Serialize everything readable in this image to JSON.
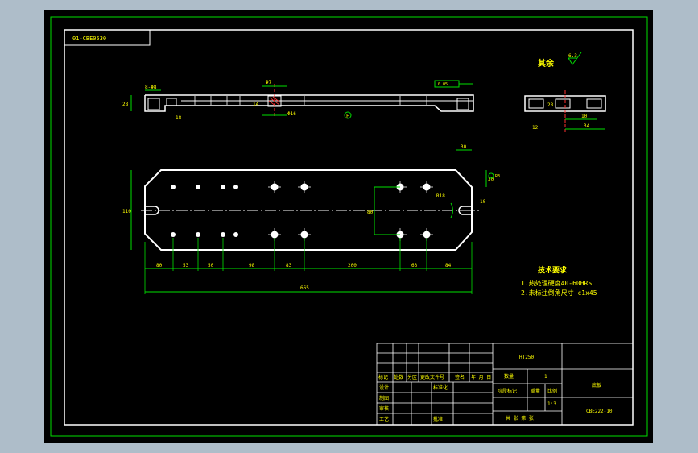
{
  "drawing_number_tag": "01-CBE0530",
  "roughness_label": "其余",
  "roughness_value": "6.3",
  "top_dims": {
    "left_width": "8-Φ8",
    "height": "28",
    "inner_height": "18",
    "hole_top": "Φ7",
    "hole_small": "14",
    "hole_bottom": "Φ16",
    "right_tol": "0.05",
    "datum": "F"
  },
  "side_dims": {
    "height": "28",
    "width1": "10",
    "width2": "34",
    "inner": "12"
  },
  "plan_dims": {
    "top_chamfer": "30",
    "right_chamfer": "30",
    "right_notch": "R3",
    "height": "110",
    "inner_height": "80",
    "arc_radius": "R18",
    "right_small": "10",
    "bottom": [
      "80",
      "53",
      "50",
      "98",
      "83",
      "200",
      "63",
      "84"
    ],
    "overall": "665"
  },
  "tech_req": {
    "title": "技术要求",
    "items": [
      "1.热处理硬度40-60HRS",
      "2.未标注倒角尺寸 c1x45"
    ]
  },
  "title_block": {
    "name_cell": "HT250",
    "part_name": "底板",
    "drawing_no": "CBE222-10",
    "qty_label": "数量",
    "qty_value": "1",
    "mark_label": "阶段标记",
    "weight_label": "重量",
    "scale_label": "比例",
    "scale_value": "1:3",
    "sheet_label": "共 张 第 张",
    "row_labels": [
      "标记",
      "处数",
      "分区",
      "更改文件号",
      "签名",
      "年 月 日"
    ],
    "left_labels": [
      "设计",
      "制图",
      "审核",
      "工艺"
    ],
    "std_label": "标准化",
    "approve_label": "批准"
  },
  "colors": {
    "frame": "#00e000",
    "line": "#ffffff",
    "dim": "#00e000",
    "text": "#ffff00",
    "center": "#ff3030"
  }
}
